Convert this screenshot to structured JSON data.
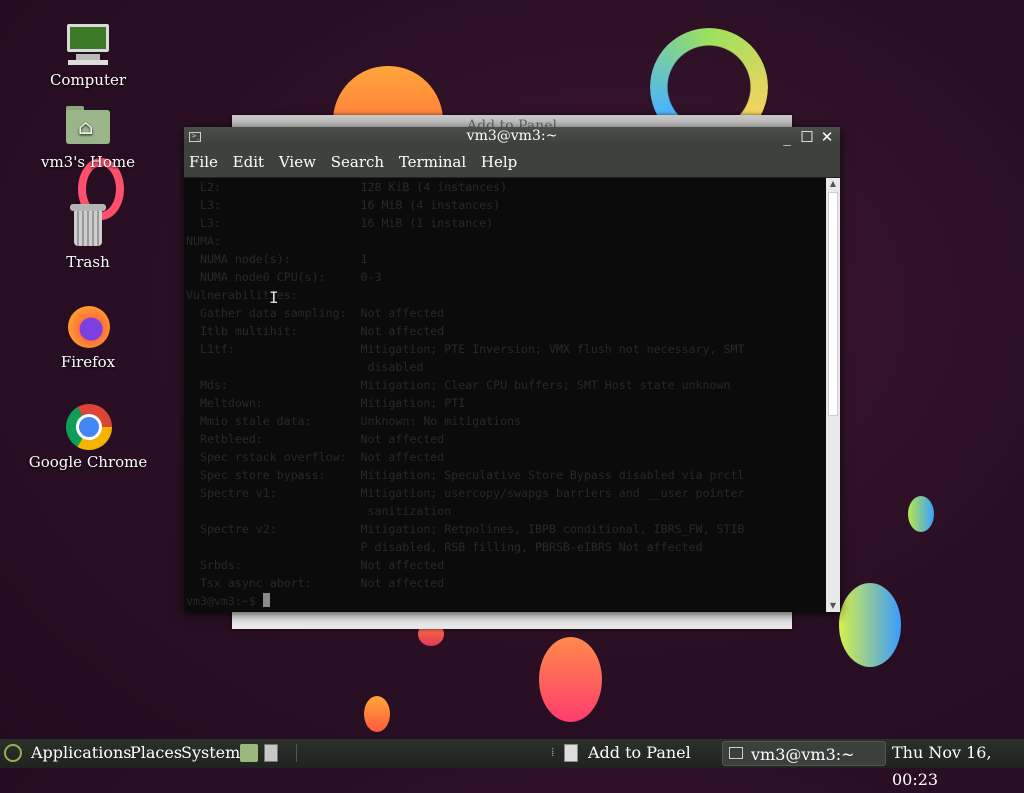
{
  "desktop": {
    "icons": [
      {
        "label": "Computer",
        "icon": "computer-icon"
      },
      {
        "label": "vm3's Home",
        "icon": "home-folder-icon"
      },
      {
        "label": "Trash",
        "icon": "trash-icon"
      },
      {
        "label": "Firefox",
        "icon": "firefox-icon"
      },
      {
        "label": "Google Chrome",
        "icon": "chrome-icon"
      }
    ]
  },
  "background_dialog": {
    "title": "Add to Panel"
  },
  "terminal": {
    "title": "vm3@vm3:~",
    "menu": [
      "File",
      "Edit",
      "View",
      "Search",
      "Terminal",
      "Help"
    ],
    "lines": [
      "  L2:                    128 KiB (4 instances)",
      "  L3:                    16 MiB (4 instances)",
      "  L3:                    16 MiB (1 instance)",
      "NUMA:",
      "  NUMA node(s):          1",
      "  NUMA node0 CPU(s):     0-3",
      "Vulnerabilities:",
      "  Gather data sampling:  Not affected",
      "  Itlb multihit:         Not affected",
      "  L1tf:                  Mitigation; PTE Inversion; VMX flush not necessary, SMT",
      "                          disabled",
      "  Mds:                   Mitigation; Clear CPU buffers; SMT Host state unknown",
      "  Meltdown:              Mitigation; PTI",
      "  Mmio stale data:       Unknown: No mitigations",
      "  Retbleed:              Not affected",
      "  Spec rstack overflow:  Not affected",
      "  Spec store bypass:     Mitigation; Speculative Store Bypass disabled via prctl",
      "  Spectre v1:            Mitigation; usercopy/swapgs barriers and __user pointer",
      "                          sanitization",
      "  Spectre v2:            Mitigation; Retpolines, IBPB conditional, IBRS_FW, STIB",
      "                         P disabled, RSB filling, PBRSB-eIBRS Not affected",
      "  Srbds:                 Not affected",
      "  Tsx async abort:       Not affected"
    ],
    "prompt": "vm3@vm3:~$ "
  },
  "panel": {
    "applications": "Applications",
    "places": "Places",
    "system": "System",
    "add_to_panel": "Add to Panel",
    "task_terminal": "vm3@vm3:~",
    "clock": "Thu Nov 16, 00:23"
  }
}
